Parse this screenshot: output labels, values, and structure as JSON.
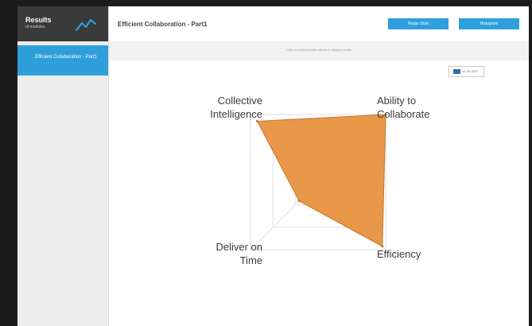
{
  "sidebar": {
    "title": "Results",
    "subtitle": "of modules",
    "items": [
      {
        "label": "Efficient Collaboration - Part1",
        "active": true
      }
    ]
  },
  "header": {
    "title": "Efficient Collaboration - Part1",
    "buttons": {
      "radar": "Radar chart",
      "histogram": "Histogram"
    }
  },
  "instruction": "Click on each module criteria to display results",
  "legend": {
    "date": "12-10-2017",
    "color": "#2f6fb0"
  },
  "colors": {
    "accent": "#2f9fdc",
    "sidebar_header": "#3a3a3a",
    "fill": "#e8913f",
    "stroke": "#c9752a"
  },
  "chart_data": {
    "type": "radar",
    "axes": [
      {
        "name_lines": [
          "Collective",
          "Intelligence"
        ]
      },
      {
        "name_lines": [
          "Ability to",
          "Collaborate"
        ]
      },
      {
        "name_lines": [
          "Efficiency"
        ]
      },
      {
        "name_lines": [
          "Deliver on",
          "Time"
        ]
      }
    ],
    "max": 100,
    "rings": 3,
    "series": [
      {
        "values": [
          90,
          100,
          95,
          28
        ]
      }
    ]
  }
}
